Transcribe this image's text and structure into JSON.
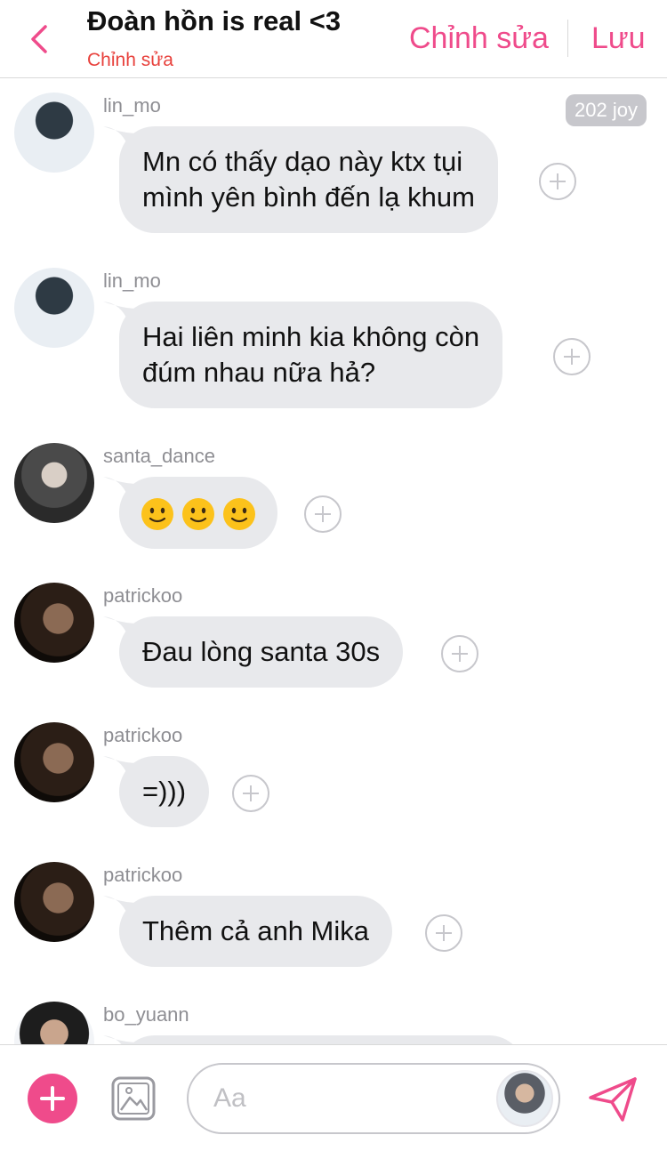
{
  "header": {
    "back_icon": "chevron-left-icon",
    "title": "Đoàn hồn is real <3",
    "subtitle": "Chỉnh sửa",
    "edit_label": "Chỉnh sửa",
    "save_label": "Lưu",
    "accent_color": "#ef4b8b",
    "subtitle_color": "#e8413c"
  },
  "messages": [
    {
      "username": "lin_mo",
      "avatar": "lin_mo-avatar",
      "lines": [
        "Mn có thấy dạo này ktx tụi",
        "mình yên bình đến lạ khum"
      ],
      "badge": "202 joy"
    },
    {
      "username": "lin_mo",
      "avatar": "lin_mo-avatar",
      "lines": [
        "Hai liên minh kia không còn",
        "đúm nhau nữa hả?"
      ]
    },
    {
      "username": "santa_dance",
      "avatar": "santa_dance-avatar",
      "emojis": [
        "slightly-smiling-face-emoji",
        "slightly-smiling-face-emoji",
        "slightly-smiling-face-emoji"
      ]
    },
    {
      "username": "patrickoo",
      "avatar": "patrickoo-avatar",
      "lines": [
        "Đau lòng santa 30s"
      ]
    },
    {
      "username": "patrickoo",
      "avatar": "patrickoo-avatar",
      "lines": [
        "=)))"
      ]
    },
    {
      "username": "patrickoo",
      "avatar": "patrickoo-avatar",
      "lines": [
        "Thêm cả anh Mika"
      ]
    },
    {
      "username": "bo_yuann",
      "avatar": "bo_yuann-avatar",
      "lines": [
        ""
      ]
    }
  ],
  "composer": {
    "add_icon": "plus-icon",
    "image_icon": "image-icon",
    "placeholder": "Aa",
    "value": "",
    "send_icon": "send-icon"
  },
  "colors": {
    "bubble": "#e8e9ec",
    "username": "#8e8e93",
    "react_border": "#c7c7cc",
    "badge_bg": "#c7c7cc"
  }
}
